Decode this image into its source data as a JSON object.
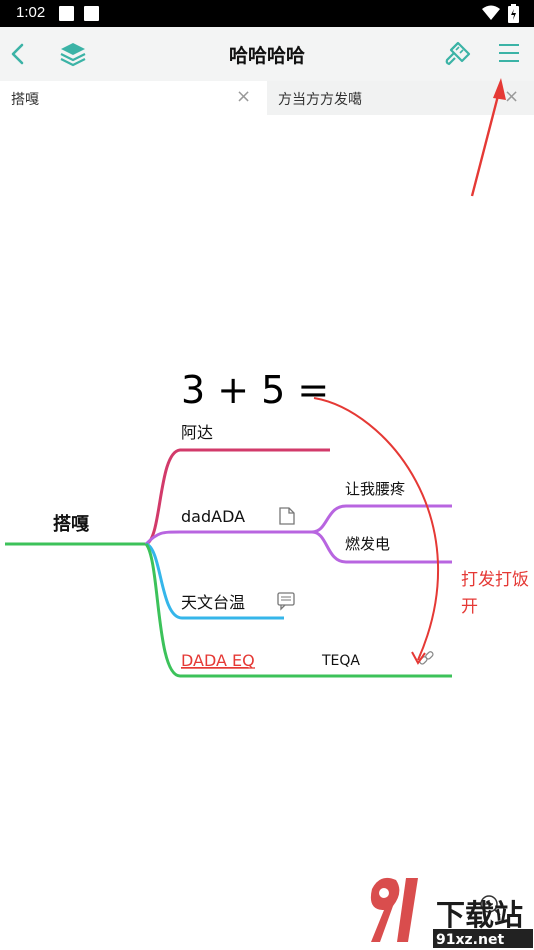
{
  "status_bar": {
    "time": "1:02"
  },
  "app_bar": {
    "title": "哈哈哈哈"
  },
  "tabs": [
    {
      "label": "搭嘎",
      "active": true
    },
    {
      "label": "方当方方发噶",
      "active": false
    }
  ],
  "mindmap": {
    "root": "搭嘎",
    "formula": "3 + 5 =",
    "nodes": {
      "a": "阿达",
      "b": "dadADA",
      "b1": "让我腰疼",
      "b2": "燃发电",
      "c": "天文台温",
      "d": "DADA EQ",
      "d1": "TEQA"
    },
    "annotation": {
      "line1": "打发打饭",
      "line2": "开"
    }
  },
  "watermark": {
    "brand": "下载站",
    "site": "91xz.net"
  },
  "colors": {
    "accent": "#3bb3a6",
    "branch_red": "#d23a6a",
    "branch_purple": "#b865e0",
    "branch_blue": "#35b6ea",
    "branch_green": "#3cc25a",
    "annotation_red": "#e53935"
  }
}
